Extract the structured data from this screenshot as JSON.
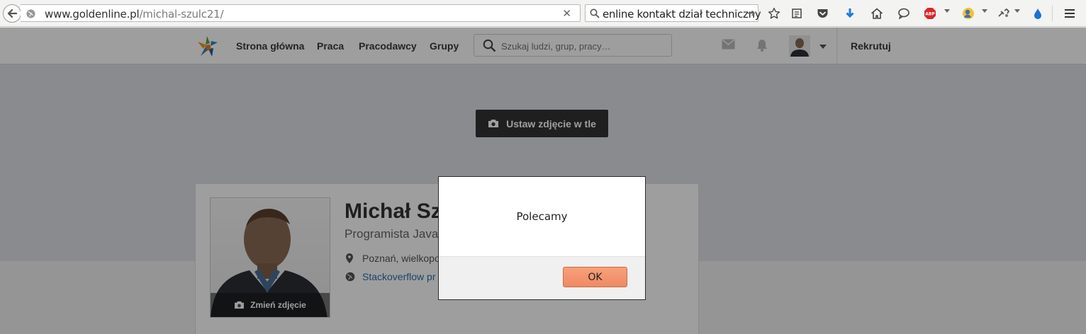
{
  "browser": {
    "url_host": "www.goldenline.pl",
    "url_path": "/michal-szulc21/",
    "search_text": "enline kontakt dział techniczny"
  },
  "site": {
    "nav": [
      "Strona główna",
      "Praca",
      "Pracodawcy",
      "Grupy"
    ],
    "search_placeholder": "Szukaj ludzi, grup, pracy…",
    "recruit_label": "Rekrutuj",
    "cover_button": "Ustaw zdjęcie w tle"
  },
  "profile": {
    "name": "Michał Szu",
    "headline": "Programista Java",
    "location": "Poznań, wielkopo",
    "link": "Stackoverflow pr",
    "change_photo": "Zmień zdjęcie"
  },
  "dialog": {
    "message": "Polecamy",
    "ok_label": "OK"
  },
  "colors": {
    "ok_button": "#ef8a62",
    "cover_button": "#333333",
    "link": "#2f6ca8"
  }
}
